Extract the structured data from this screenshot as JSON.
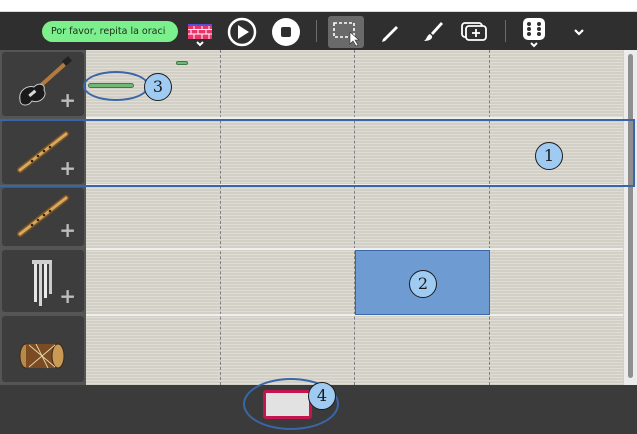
{
  "toolbar": {
    "speech_text": "Por favor, repita la oraci",
    "icons": [
      "brick-wall-icon",
      "play-icon",
      "stop-icon",
      "select-icon",
      "pencil-icon",
      "brush-icon",
      "add-icon",
      "dice-icon",
      "chevron-down-icon"
    ]
  },
  "instruments": [
    {
      "name": "electric-guitar",
      "add": "+"
    },
    {
      "name": "flute",
      "add": "+"
    },
    {
      "name": "flute",
      "add": "+"
    },
    {
      "name": "wind-chimes",
      "add": "+"
    },
    {
      "name": "drum",
      "add": ""
    }
  ],
  "annotations": {
    "one": "1",
    "two": "2",
    "three": "3",
    "four": "4"
  },
  "colors": {
    "accent": "#6e9bd1",
    "speech": "#7cf08c",
    "highlight": "#c31650",
    "note": "#6fb878"
  }
}
